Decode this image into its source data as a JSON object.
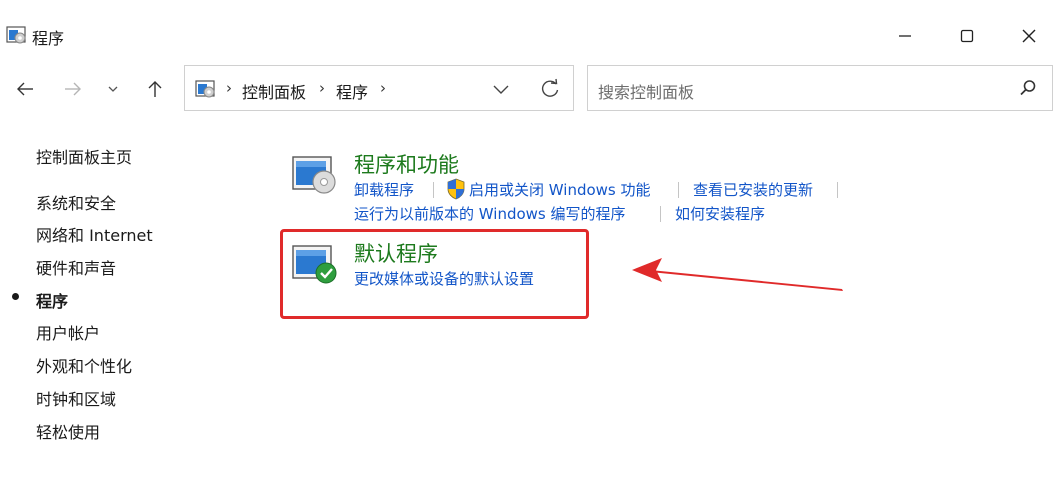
{
  "window": {
    "title": "程序",
    "icon": "control-panel-icon",
    "controls": [
      "minimize-icon",
      "maximize-icon",
      "close-icon"
    ]
  },
  "nav": {
    "back": "back-arrow-icon",
    "forward": "forward-arrow-icon",
    "recent": "chevron-down-icon",
    "up": "up-arrow-icon"
  },
  "address": {
    "breadcrumbs": [
      "控制面板",
      "程序"
    ],
    "separator": "›"
  },
  "search": {
    "placeholder": "搜索控制面板"
  },
  "sidebar": {
    "home": "控制面板主页",
    "items": [
      {
        "label": "系统和安全",
        "active": false
      },
      {
        "label": "网络和 Internet",
        "active": false
      },
      {
        "label": "硬件和声音",
        "active": false
      },
      {
        "label": "程序",
        "active": true
      },
      {
        "label": "用户帐户",
        "active": false
      },
      {
        "label": "外观和个性化",
        "active": false
      },
      {
        "label": "时钟和区域",
        "active": false
      },
      {
        "label": "轻松使用",
        "active": false
      }
    ]
  },
  "categories": [
    {
      "title": "程序和功能",
      "icon": "programs-features-icon",
      "links": [
        "卸载程序",
        "启用或关闭 Windows 功能",
        "查看已安装的更新",
        "运行为以前版本的 Windows 编写的程序",
        "如何安装程序"
      ]
    },
    {
      "title": "默认程序",
      "icon": "default-programs-icon",
      "links": [
        "更改媒体或设备的默认设置"
      ]
    }
  ],
  "colors": {
    "category_title": "#1d7a1d",
    "link": "#1255c8",
    "highlight_box": "#e02a2a",
    "annotation_arrow": "#e02a2a"
  }
}
